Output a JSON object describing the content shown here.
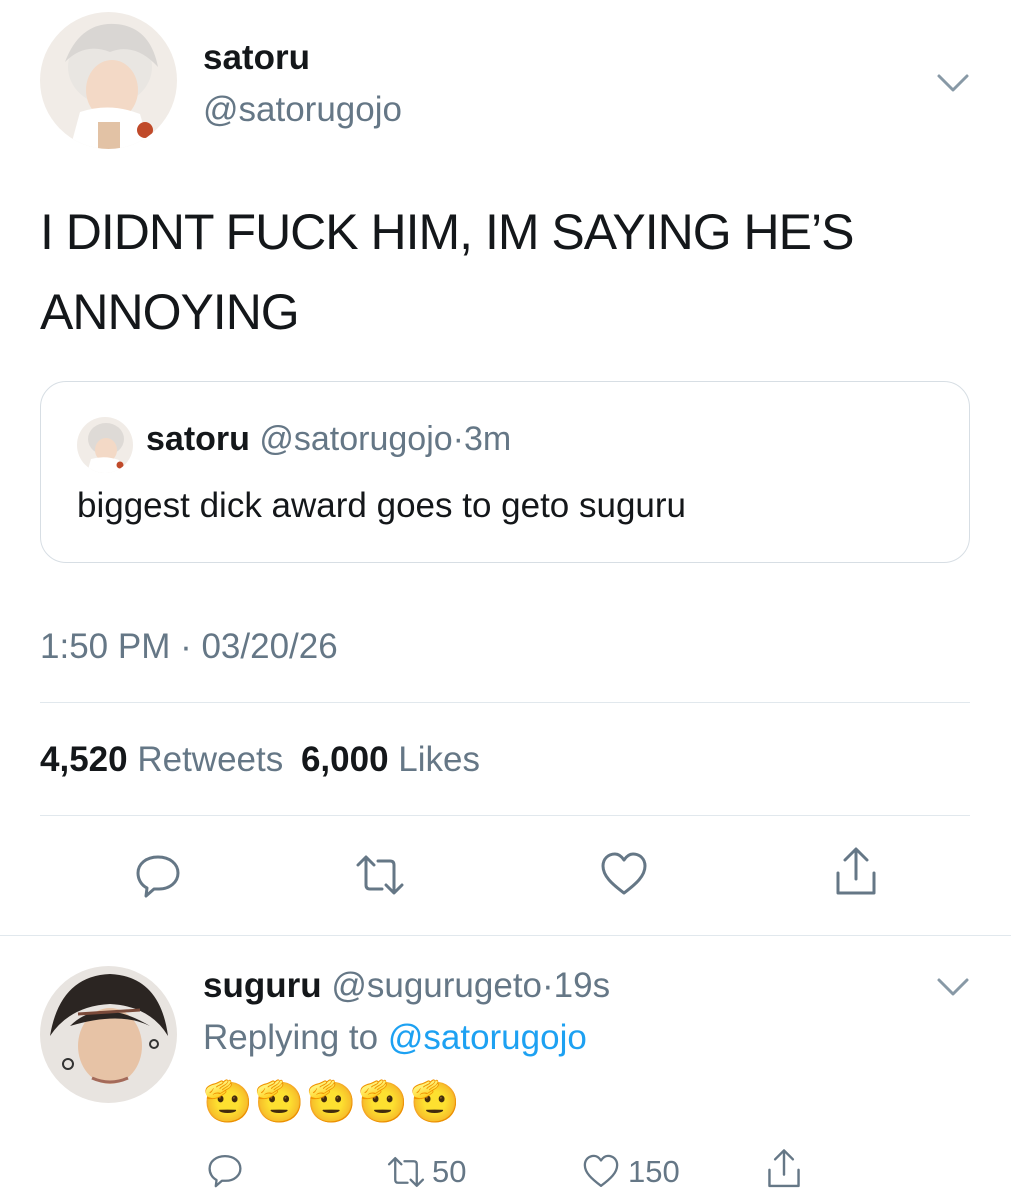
{
  "tweet": {
    "display_name": "satoru",
    "handle": "@satorugojo",
    "text": "I DIDNT FUCK HIM, IM SAYING HE’S ANNOYING",
    "quote": {
      "display_name": "satoru",
      "handle": "@satorugojo",
      "sep": "·",
      "time": "3m",
      "text": "biggest dick award goes to geto suguru"
    },
    "timestamp": "1:50 PM · 03/20/26",
    "retweets_count": "4,520",
    "retweets_label": "Retweets",
    "likes_count": "6,000",
    "likes_label": "Likes"
  },
  "reply": {
    "display_name": "suguru",
    "handle": "@sugurugeto",
    "sep": "·",
    "time": "19s",
    "replying_prefix": "Replying to",
    "replying_to": "@satorugojo",
    "text": "🫡🫡🫡🫡🫡",
    "retweet_count": "50",
    "like_count": "150"
  },
  "icons": {
    "menu": "chevron-down-icon",
    "reply": "reply-icon",
    "retweet": "retweet-icon",
    "like": "heart-icon",
    "share": "share-icon"
  },
  "colors": {
    "text": "#14171a",
    "muted": "#657786",
    "link": "#1da1f2",
    "divider": "#e1e8ed"
  }
}
